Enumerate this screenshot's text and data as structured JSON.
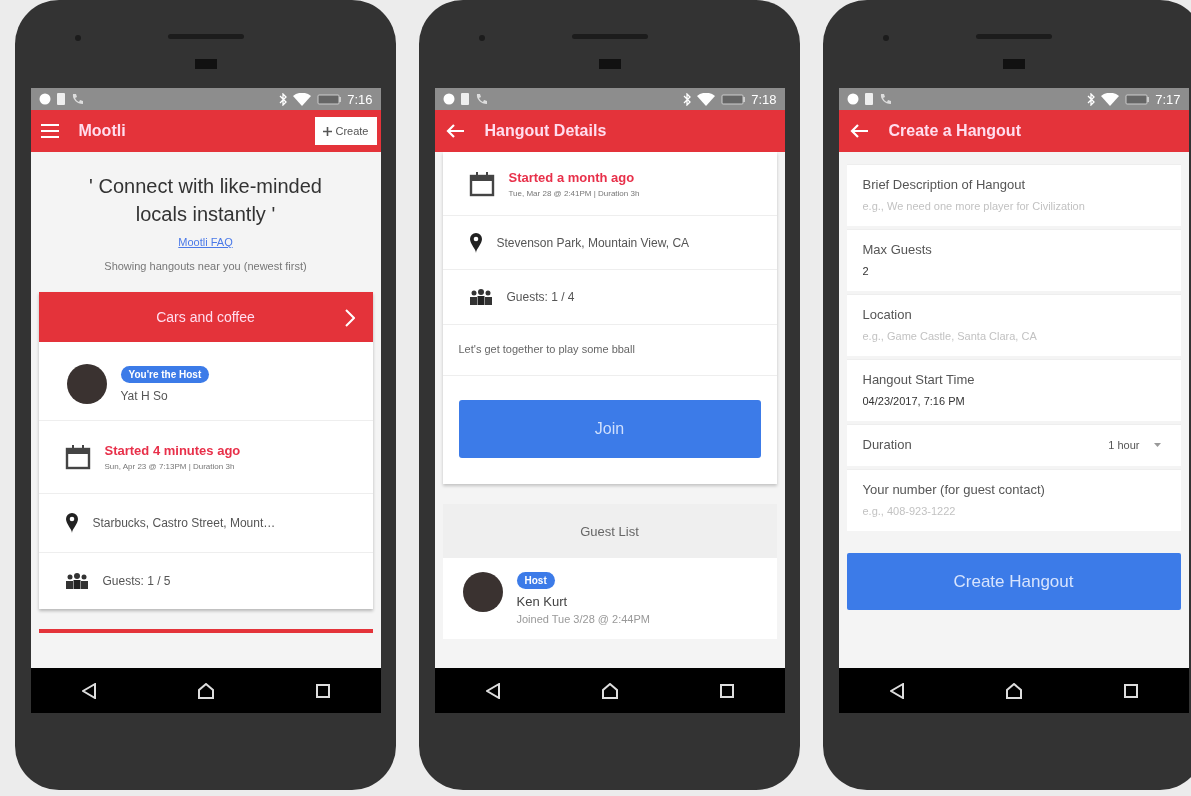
{
  "phones": [
    {
      "kind": "home",
      "time": "7:16",
      "app_bar": {
        "kind": "menu",
        "title": "Mootli",
        "action": "Create"
      },
      "tagline": "' Connect with like-minded locals instantly '",
      "faq_link": "Mootli FAQ",
      "note": "Showing hangouts near you (newest first)",
      "hangout": {
        "title": "Cars and coffee",
        "host_badge": "You're the Host",
        "host_name": "Yat H So",
        "status": "Started 4 minutes ago",
        "schedule": "Sun, Apr 23 @ 7:13PM | Duration 3h",
        "location": "Starbucks, Castro Street, Mount…",
        "guests": "Guests: 1 / 5"
      }
    },
    {
      "kind": "details",
      "time": "7:18",
      "app_bar": {
        "kind": "back",
        "title": "Hangout Details"
      },
      "status": "Started a month ago",
      "schedule": "Tue, Mar 28 @ 2:41PM | Duration 3h",
      "location": "Stevenson Park, Mountain View, CA",
      "guests": "Guests: 1 / 4",
      "description": "Let's get together to play some bball",
      "join_button": "Join",
      "guest_list": {
        "title": "Guest List",
        "guests": [
          {
            "badge": "Host",
            "name": "Ken Kurt",
            "joined": "Joined Tue 3/28 @ 2:44PM"
          }
        ]
      }
    },
    {
      "kind": "create",
      "time": "7:17",
      "app_bar": {
        "kind": "back",
        "title": "Create a Hangout"
      },
      "fields": [
        {
          "kind": "text",
          "label": "Brief Description of Hangout",
          "placeholder": "e.g., We need one more player for Civilization"
        },
        {
          "kind": "text",
          "label": "Max Guests",
          "value": "2"
        },
        {
          "kind": "text",
          "label": "Location",
          "placeholder": "e.g., Game Castle, Santa Clara, CA"
        },
        {
          "kind": "text",
          "label": "Hangout Start Time",
          "value": "04/23/2017, 7:16 PM"
        },
        {
          "kind": "select",
          "label": "Duration",
          "value": "1 hour"
        },
        {
          "kind": "text",
          "label": "Your number (for guest contact)",
          "placeholder": "e.g., 408-923-1222"
        }
      ],
      "submit": "Create Hangout"
    }
  ]
}
